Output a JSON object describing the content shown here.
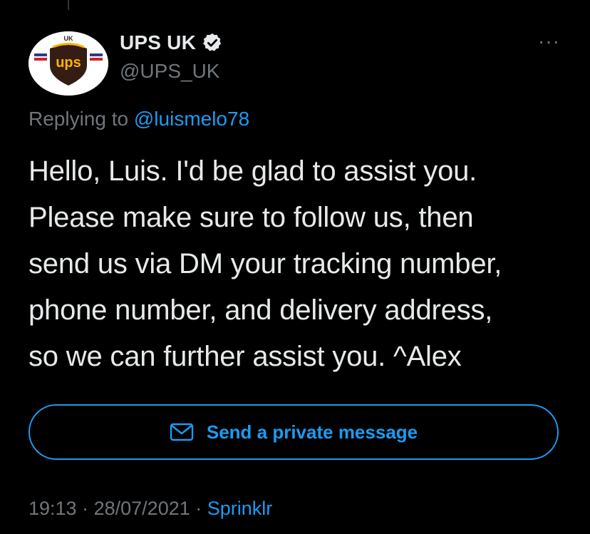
{
  "author": {
    "display_name": "UPS UK",
    "handle": "@UPS_UK",
    "avatar_label": "UK",
    "logo_text": "ups",
    "verified": true
  },
  "reply": {
    "prefix": "Replying to",
    "mention": "@luismelo78"
  },
  "tweet": {
    "lines": [
      "Hello, Luis. I'd be glad to assist you.",
      "Please make sure to follow us, then",
      "send us via DM your tracking number,",
      "phone number, and delivery address,",
      "so we can further assist you. ^Alex"
    ]
  },
  "actions": {
    "dm_label": "Send a private message",
    "more_label": "···"
  },
  "meta": {
    "time": "19:13",
    "separator": "·",
    "date": "28/07/2021",
    "source": "Sprinklr"
  },
  "colors": {
    "background": "#000000",
    "accent": "#1d9bf0",
    "text": "#e7e9ea",
    "muted": "#71767b",
    "ups_brown": "#351c15",
    "ups_gold": "#ffb500"
  },
  "icons": [
    "verified-badge-icon",
    "envelope-icon",
    "more-options-icon",
    "ups-logo"
  ]
}
